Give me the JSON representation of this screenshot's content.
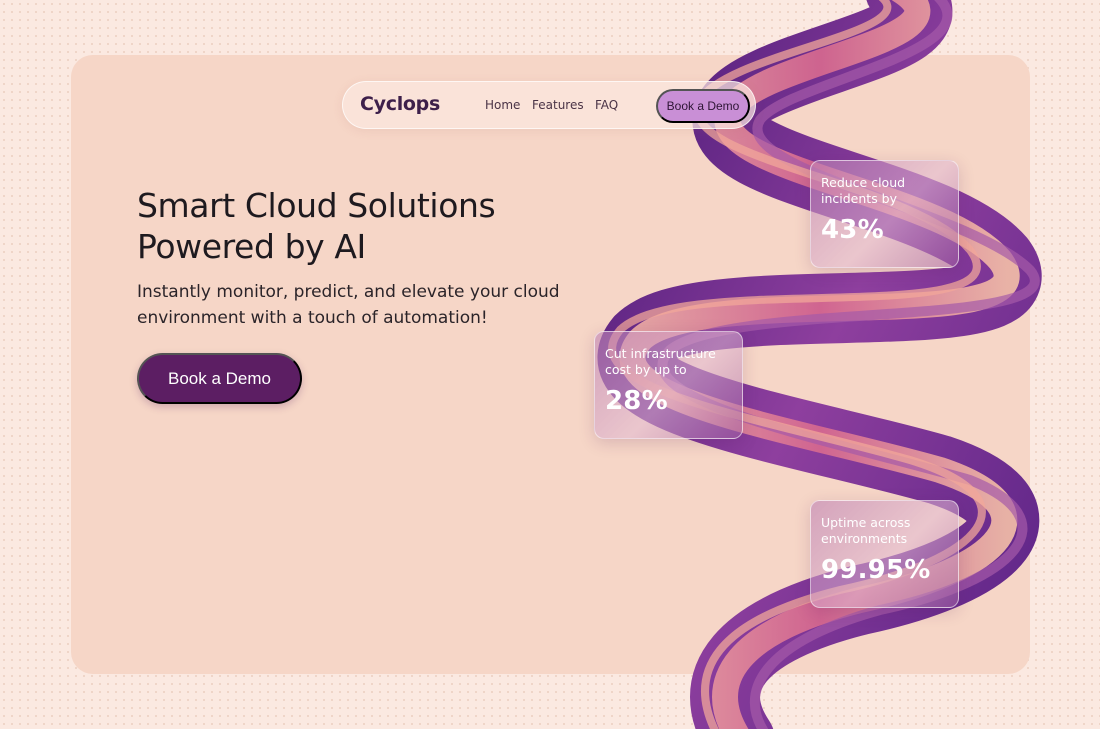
{
  "nav": {
    "logo": "Cyclops",
    "links": [
      "Home",
      "Features",
      "FAQ"
    ],
    "cta": "Book a Demo"
  },
  "hero": {
    "headline_line1": "Smart Cloud Solutions",
    "headline_line2": "Powered by AI",
    "subtitle": "Instantly monitor, predict, and elevate your cloud environment with a touch of automation!",
    "cta": "Book a Demo"
  },
  "stats": [
    {
      "label": "Reduce cloud incidents by",
      "value": "43%"
    },
    {
      "label": "Cut infrastructure cost by up to",
      "value": "28%"
    },
    {
      "label": "Uptime across environments",
      "value": "99.95%"
    }
  ],
  "colors": {
    "page_bg": "#fbe9e1",
    "hero_bg": "#f6d6c7",
    "primary": "#5c1e63",
    "nav_cta": "#c98fd6",
    "ribbon_purple": "#6a2a8c",
    "ribbon_pink": "#e38a9e"
  }
}
